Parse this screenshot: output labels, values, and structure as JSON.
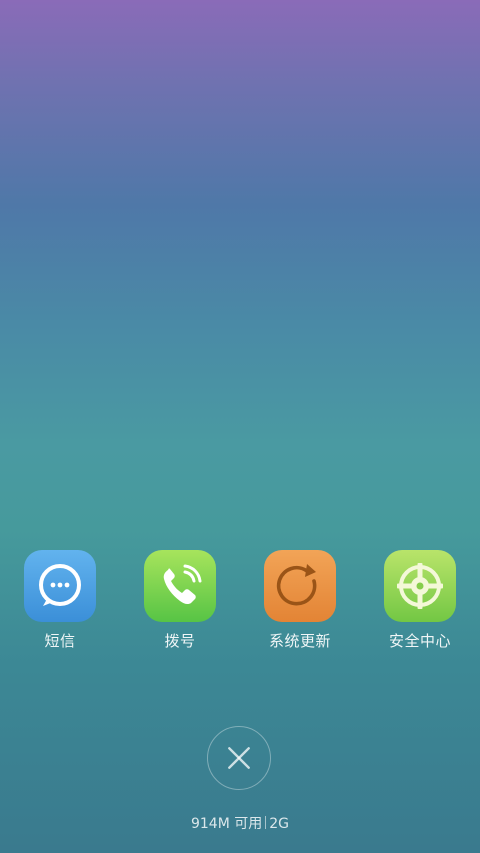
{
  "apps": [
    {
      "label": "短信",
      "icon": "message-bubble-icon"
    },
    {
      "label": "拨号",
      "icon": "phone-icon"
    },
    {
      "label": "系统更新",
      "icon": "refresh-icon"
    },
    {
      "label": "安全中心",
      "icon": "security-crosshair-icon"
    }
  ],
  "memory": {
    "available": "914M 可用",
    "total": "2G"
  },
  "close": {
    "icon": "close-icon"
  }
}
